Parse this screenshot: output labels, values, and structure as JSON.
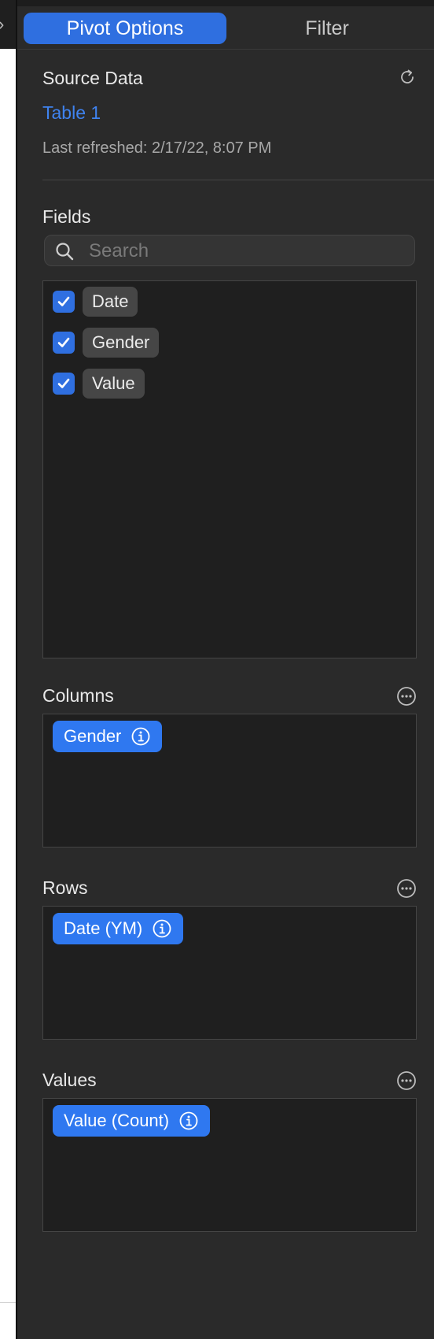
{
  "tabs": {
    "pivot_options": "Pivot Options",
    "filter": "Filter"
  },
  "source_data": {
    "title": "Source Data",
    "table_link": "Table 1",
    "last_refreshed": "Last refreshed: 2/17/22, 8:07 PM"
  },
  "fields": {
    "title": "Fields",
    "search_placeholder": "Search",
    "search_value": "",
    "items": [
      {
        "label": "Date",
        "checked": true
      },
      {
        "label": "Gender",
        "checked": true
      },
      {
        "label": "Value",
        "checked": true
      }
    ]
  },
  "columns": {
    "title": "Columns",
    "items": [
      {
        "label": "Gender"
      }
    ]
  },
  "rows": {
    "title": "Rows",
    "items": [
      {
        "label": "Date (YM)"
      }
    ]
  },
  "values": {
    "title": "Values",
    "items": [
      {
        "label": "Value (Count)"
      }
    ]
  },
  "colors": {
    "accent": "#2f6fe0",
    "pill": "#2f78f0",
    "link": "#3f83f0",
    "panel_bg": "#2a2a2a",
    "box_bg": "#1f1f1f"
  },
  "icons": {
    "refresh": "refresh-icon",
    "search": "search-icon",
    "more": "ellipsis-circle-icon",
    "info": "info-circle-icon",
    "check": "checkmark-icon",
    "collapse": "chevron-right-icon"
  }
}
